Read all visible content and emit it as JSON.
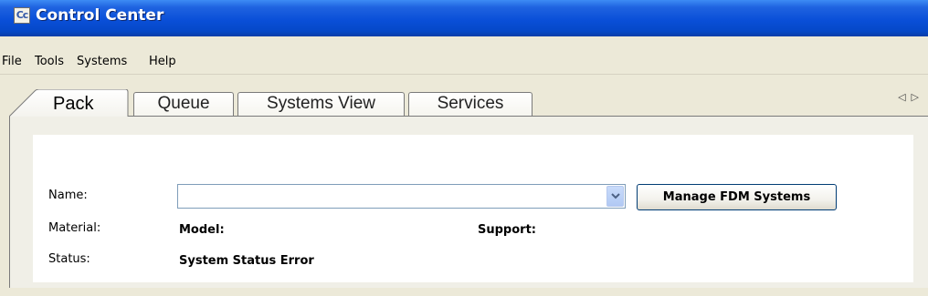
{
  "window": {
    "title": "Control Center",
    "icon": "control-center-app-icon",
    "icon_text": "Cc"
  },
  "menu": [
    "File",
    "Tools",
    "Systems",
    "Help"
  ],
  "tabs": [
    {
      "label": "Pack",
      "selected": true
    },
    {
      "label": "Queue",
      "selected": false
    },
    {
      "label": "Systems View",
      "selected": false
    },
    {
      "label": "Services",
      "selected": false
    }
  ],
  "tab_scroll": {
    "left_icon": "triangle-left-icon",
    "right_icon": "triangle-right-icon",
    "left": "◁",
    "right": "▷"
  },
  "form": {
    "name_label": "Name:",
    "name_value": "",
    "material_label": "Material:",
    "status_label": "Status:",
    "model_label": "Model:",
    "support_label": "Support:",
    "status_value": "System Status Error",
    "manage_button": "Manage FDM Systems"
  },
  "colors": {
    "titlebar": "#0548c8",
    "window_bg": "#ece9d8",
    "combo_border": "#7f9db9",
    "button_border": "#003c74"
  }
}
